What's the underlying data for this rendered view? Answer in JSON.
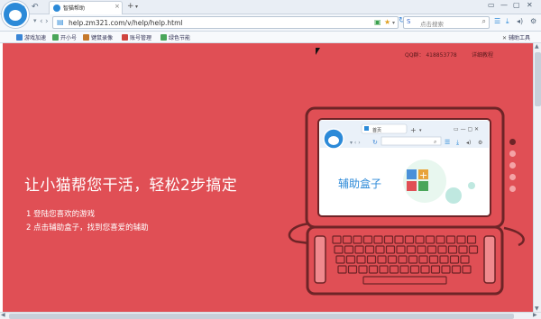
{
  "browser": {
    "tab_title": "智猫帮助",
    "tab_close": "×",
    "new_tab": "+",
    "new_tab_dropdown": "▾",
    "url": "help.zm321.com/v/help/help.html",
    "search_engine": "S",
    "search_placeholder": "点击搜索",
    "window_controls": [
      "▭",
      "—",
      "▢",
      "✕"
    ],
    "nav": {
      "back": "‹",
      "forward": "›",
      "reload": "↻",
      "back_small": "↶"
    }
  },
  "bookmarks": [
    {
      "label": "游戏加速",
      "color": "#3b86d6"
    },
    {
      "label": "开小号",
      "color": "#4aa65a"
    },
    {
      "label": "键鼠录像",
      "color": "#c6792b"
    },
    {
      "label": "账号管理",
      "color": "#d0453f"
    },
    {
      "label": "绿色节能",
      "color": "#4aa65a"
    }
  ],
  "bookmarks_right": {
    "label": "辅助工具",
    "icon": "tools-icon"
  },
  "page": {
    "qq_group": "QQ群： 418853778",
    "detail_link": "详细教程",
    "headline": "让小猫帮您干活，轻松2步搞定",
    "steps": [
      "1  登陆您喜欢的游戏",
      "2  点击辅助盒子，找到您喜爱的辅助"
    ],
    "mini_browser": {
      "tab": "首页",
      "box_label": "辅助盒子"
    },
    "carousel": {
      "count": 5,
      "active_index": 0
    }
  },
  "colors": {
    "page_bg": "#e04f55",
    "laptop_outline": "#6e2427",
    "accent_blue": "#2c8ad8"
  }
}
